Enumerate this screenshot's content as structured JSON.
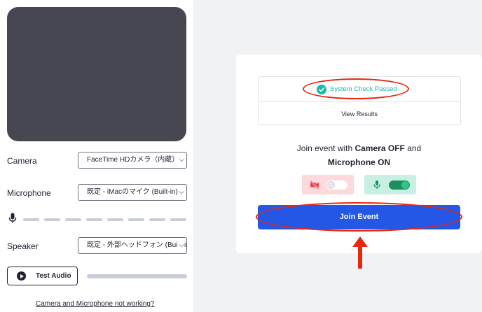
{
  "left_panel": {
    "camera_label": "Camera",
    "camera_value": "FaceTime HDカメラ（内蔵）",
    "microphone_label": "Microphone",
    "microphone_value": "既定 - iMacのマイク (Built-in)",
    "speaker_label": "Speaker",
    "speaker_value": "既定 - 外部ヘッドフォン (Built-in)",
    "test_audio_label": "Test Audio",
    "help_link": "Camera and Microphone not working?"
  },
  "system_check": {
    "status": "System Check Passed",
    "view_results": "View Results"
  },
  "join": {
    "text_prefix": "Join event with ",
    "camera_state": "Camera OFF",
    "text_mid": " and",
    "microphone_state": "Microphone ON",
    "button_label": "Join Event"
  },
  "toggles": {
    "camera_enabled": false,
    "microphone_enabled": true
  },
  "icons": {
    "chevron": "chevron-down-icon",
    "mic": "microphone-icon",
    "play": "play-icon",
    "check": "check-circle-icon",
    "camera_off": "camera-off-icon",
    "arrow": "arrow-up-icon"
  },
  "colors": {
    "primary": "#2457e5",
    "success": "#1cb8a4",
    "annotation": "#e8270f",
    "camera_pill": "#fcd9db",
    "mic_pill": "#c8efe3",
    "toggle_on": "#1b8f5c"
  }
}
